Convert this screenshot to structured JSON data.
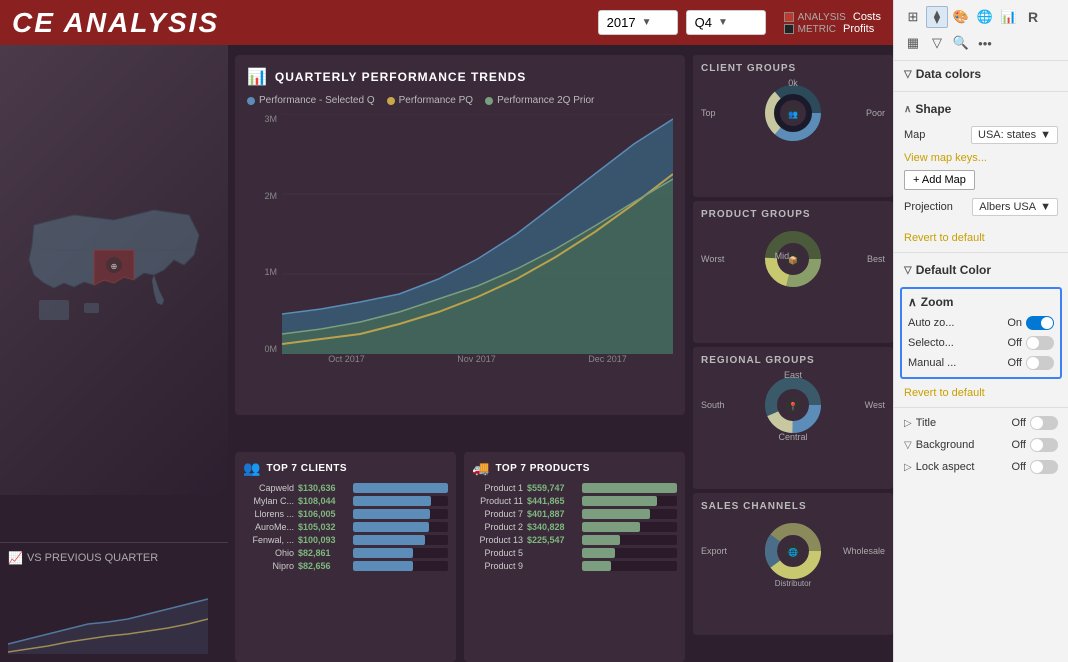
{
  "header": {
    "title": "CE ANALYSIS",
    "year_value": "2017",
    "year_placeholder": "2017",
    "quarter_value": "Q4",
    "quarter_placeholder": "Q4",
    "analysis_label": "ANALYSIS",
    "metric_label": "METRIC",
    "costs_label": "Costs",
    "profits_label": "Profits"
  },
  "quarterly": {
    "title": "QUARTERLY PERFORMANCE TRENDS",
    "legend": [
      {
        "label": "Performance - Selected Q",
        "color": "#5b8db8"
      },
      {
        "label": "Performance PQ",
        "color": "#c8a84b"
      },
      {
        "label": "Performance 2Q Prior",
        "color": "#7a9e7e"
      }
    ],
    "y_labels": [
      "3M",
      "2M",
      "1M",
      "0M"
    ],
    "x_labels": [
      "Oct 2017",
      "Nov 2017",
      "Dec 2017"
    ]
  },
  "client_groups": {
    "title": "CLIENT GROUPS",
    "labels": {
      "top": "0k",
      "right": "Poor",
      "left": "Top"
    }
  },
  "product_groups": {
    "title": "PRODUCT GROUPS",
    "labels": {
      "right": "Best",
      "left": "Worst",
      "center": "Mid"
    }
  },
  "regional_groups": {
    "title": "REGIONAL GROUPS",
    "labels": {
      "top": "East",
      "left": "South",
      "bottom": "Central",
      "right": "West"
    }
  },
  "sales_channels": {
    "title": "SALES CHANNELS",
    "labels": {
      "left": "Export",
      "right": "Wholesale",
      "bottom": "Distributor"
    }
  },
  "top_clients": {
    "title": "TOP 7 CLIENTS",
    "rows": [
      {
        "name": "Capweld",
        "value": "$130,636",
        "pct": 100
      },
      {
        "name": "Mylan C...",
        "value": "$108,044",
        "pct": 82
      },
      {
        "name": "Llorens ...",
        "value": "$106,005",
        "pct": 81
      },
      {
        "name": "AuroMe...",
        "value": "$105,032",
        "pct": 80
      },
      {
        "name": "Fenwal, ...",
        "value": "$100,093",
        "pct": 76
      },
      {
        "name": "Ohio",
        "value": "$82,861",
        "pct": 63
      },
      {
        "name": "Nipro",
        "value": "$82,656",
        "pct": 63
      }
    ]
  },
  "top_products": {
    "title": "TOP 7 PRODUCTS",
    "rows": [
      {
        "name": "Product 1",
        "value": "$559,747",
        "pct": 100
      },
      {
        "name": "Product 11",
        "value": "$441,865",
        "pct": 79
      },
      {
        "name": "Product 7",
        "value": "$401,887",
        "pct": 72
      },
      {
        "name": "Product 2",
        "value": "$340,828",
        "pct": 61
      },
      {
        "name": "Product 13",
        "value": "$225,547",
        "pct": 40
      },
      {
        "name": "Product 5",
        "value": "",
        "pct": 35
      },
      {
        "name": "Product 9",
        "value": "",
        "pct": 30
      }
    ]
  },
  "vs_section": {
    "title": "VS PREVIOUS QUARTER"
  },
  "right_panel": {
    "data_colors_label": "Data colors",
    "shape_label": "Shape",
    "map_label": "Map",
    "map_value": "USA: states",
    "view_map_keys_label": "View map keys...",
    "add_map_label": "+ Add Map",
    "projection_label": "Projection",
    "projection_value": "Albers USA",
    "revert_label": "Revert to default",
    "default_color_label": "Default Color",
    "zoom_label": "Zoom",
    "auto_zoom_label": "Auto zo...",
    "auto_zoom_state": "On",
    "selection_label": "Selecto...",
    "selection_state": "Off",
    "manual_label": "Manual ...",
    "manual_state": "Off",
    "revert2_label": "Revert to default",
    "title_label": "Title",
    "title_state": "Off",
    "background_label": "Background",
    "background_state": "Off",
    "lock_aspect_label": "Lock aspect",
    "lock_aspect_state": "Off"
  }
}
